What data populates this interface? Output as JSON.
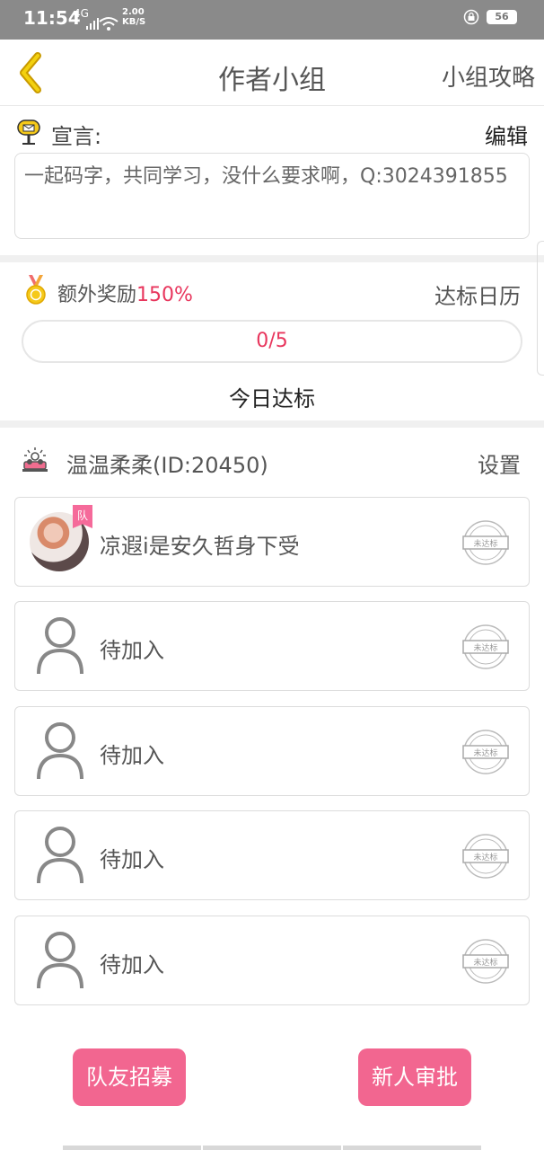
{
  "status_bar": {
    "time": "11:54",
    "network": "4G",
    "speed_value": "2.00",
    "speed_unit": "KB/S",
    "battery": "56"
  },
  "header": {
    "title": "作者小组",
    "right_link": "小组攻略"
  },
  "manifesto": {
    "label": "宣言:",
    "edit": "编辑",
    "text": "一起码字，共同学习，没什么要求啊，Q:3024391855"
  },
  "reward": {
    "label": "额外奖励",
    "percent": "150%",
    "calendar": "达标日历",
    "progress_text": "0/5",
    "progress_fraction": 0,
    "today_label": "今日达标"
  },
  "team": {
    "name": "温温柔柔(ID:20450)",
    "settings": "设置",
    "members": [
      {
        "name": "凉遐i是安久哲身下受",
        "badge": "队",
        "stamp": "未达标",
        "has_avatar": true
      },
      {
        "name": "待加入",
        "stamp": "未达标"
      },
      {
        "name": "待加入",
        "stamp": "未达标"
      },
      {
        "name": "待加入",
        "stamp": "未达标"
      },
      {
        "name": "待加入",
        "stamp": "未达标"
      }
    ]
  },
  "actions": {
    "recruit": "队友招募",
    "approve": "新人审批"
  },
  "colors": {
    "accent_pink": "#f26690",
    "highlight_red": "#e8365d",
    "back_arrow": "#e6b800"
  }
}
